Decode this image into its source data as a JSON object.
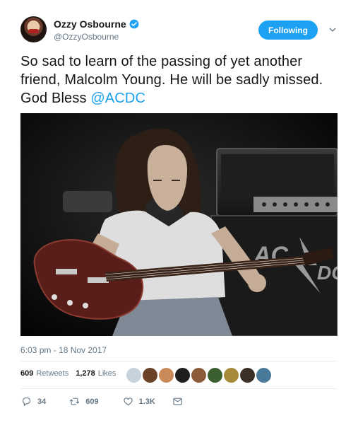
{
  "user": {
    "display_name": "Ozzy Osbourne",
    "handle": "@OzzyOsbourne",
    "verified": true
  },
  "follow_button_label": "Following",
  "tweet": {
    "text_main": "So sad to learn of the passing of yet another friend, Malcolm Young. He will be sadly missed. God Bless ",
    "mention": "@ACDC",
    "timestamp": "6:03 pm - 18 Nov 2017"
  },
  "stats": {
    "retweets_count": "609",
    "retweets_label": "Retweets",
    "likes_count": "1,278",
    "likes_label": "Likes"
  },
  "actions": {
    "replies": "34",
    "retweets": "609",
    "likes": "1.3K"
  },
  "colors": {
    "accent": "#1da1f2",
    "text": "#14171a",
    "muted": "#657786",
    "divider": "#e6ecf0"
  },
  "icons": [
    "verified-badge-icon",
    "chevron-down-icon",
    "reply-icon",
    "retweet-icon",
    "like-icon",
    "direct-message-icon"
  ]
}
